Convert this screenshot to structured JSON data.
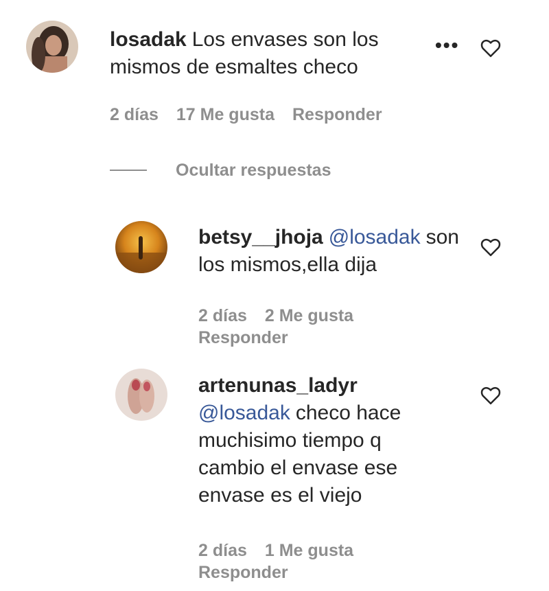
{
  "comment_main": {
    "username": "losadak",
    "text": "Los envases son los mismos de esmaltes checo",
    "time": "2 días",
    "likes": "17 Me gusta",
    "reply_label": "Responder",
    "more_icon": "more-options-icon",
    "like_icon": "heart-icon"
  },
  "hide_replies": {
    "label": "Ocultar respuestas"
  },
  "replies": [
    {
      "username": "betsy__jhoja",
      "mention": "@losadak",
      "text": "son los mismos,ella dija",
      "time": "2 días",
      "likes": "2 Me gusta",
      "reply_label": "Responder",
      "like_icon": "heart-icon"
    },
    {
      "username": "artenunas_ladyr",
      "mention": "@losadak",
      "text": "checo hace muchisimo tiempo q cambio el envase ese envase es el viejo",
      "time": "2 días",
      "likes": "1 Me gusta",
      "reply_label": "Responder",
      "like_icon": "heart-icon"
    }
  ],
  "colors": {
    "text": "#262626",
    "secondary": "#8e8e8e",
    "mention": "#385898"
  }
}
